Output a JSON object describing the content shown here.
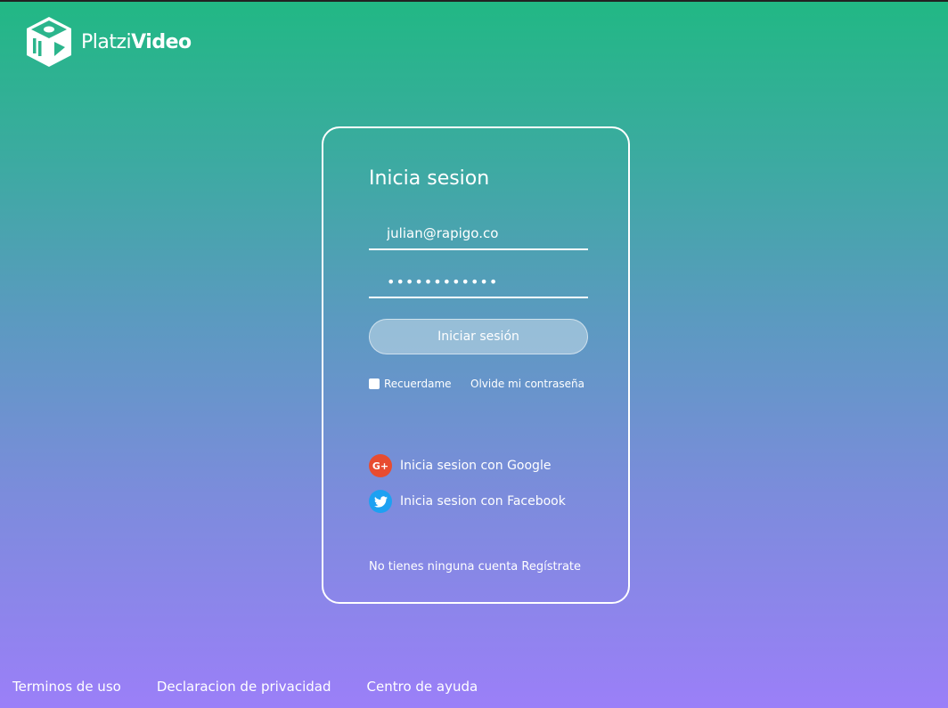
{
  "brand": {
    "name_light": "Platzi",
    "name_bold": "Video"
  },
  "login": {
    "title": "Inicia sesion",
    "email_value": "julian@rapigo.co",
    "password_value": "••••••••••••",
    "submit_label": "Iniciar sesión",
    "remember_label": "Recuerdame",
    "remember_checked": false,
    "forgot_label": "Olvide mi contraseña"
  },
  "social": {
    "google_label": "Inicia sesion con Google",
    "google_icon": "google-plus-icon",
    "google_color": "#e84c30",
    "twitter_label": "Inicia sesion con Facebook",
    "twitter_icon": "twitter-bird-icon",
    "twitter_color": "#1da1f2"
  },
  "register": {
    "text": "No tienes ninguna cuenta",
    "link": "Regístrate"
  },
  "footer": {
    "links": [
      "Terminos de uso",
      "Declaracion de privacidad",
      "Centro de ayuda"
    ]
  },
  "colors": {
    "gradient_top": "#21b884",
    "gradient_bottom": "#9b7ff8"
  }
}
